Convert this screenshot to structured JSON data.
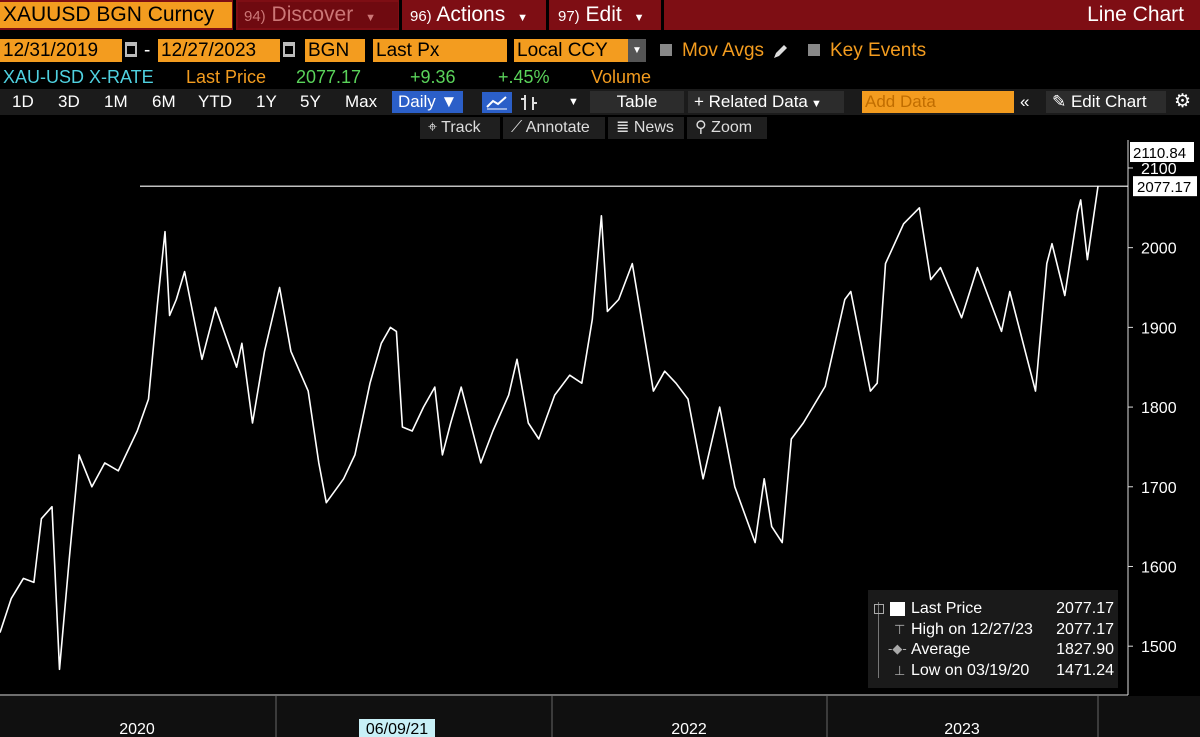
{
  "topbar": {
    "ticker": "XAUUSD BGN Curncy",
    "discover_num": "94)",
    "discover": "Discover",
    "actions_num": "96)",
    "actions": "Actions",
    "edit_num": "97)",
    "edit": "Edit",
    "chart_type": "Line Chart"
  },
  "options": {
    "start_date": "12/31/2019",
    "dash": "-",
    "end_date": "12/27/2023",
    "source": "BGN",
    "field": "Last Px",
    "currency": "Local CCY",
    "mov_avgs": "Mov Avgs",
    "key_events": "Key Events"
  },
  "security": {
    "name": "XAU-USD X-RATE",
    "last_price_label": "Last Price",
    "last_price": "2077.17",
    "change": "+9.36",
    "change_pct": "+.45%",
    "volume_label": "Volume"
  },
  "toolbar": {
    "periods": [
      "1D",
      "3D",
      "1M",
      "6M",
      "YTD",
      "1Y",
      "5Y",
      "Max"
    ],
    "frequency": "Daily",
    "table": "Table",
    "related_data": "Related Data",
    "add_data_placeholder": "Add Data",
    "edit_chart": "Edit Chart"
  },
  "tools": {
    "track": "Track",
    "annotate": "Annotate",
    "news": "News",
    "zoom": "Zoom"
  },
  "legend": {
    "last_price_label": "Last Price",
    "last_price": "2077.17",
    "high_label": "High on 12/27/23",
    "high": "2077.17",
    "average_label": "Average",
    "average": "1827.90",
    "low_label": "Low on 03/19/20",
    "low": "1471.24"
  },
  "colors": {
    "orange": "#f39c1f",
    "header_red": "#7e0e14",
    "cyan": "#4fd1e0",
    "green": "#5ad35a",
    "line": "#ffffff"
  },
  "chart_data": {
    "type": "line",
    "series": [
      {
        "name": "Last Price",
        "x": [
          "2019-12-31",
          "2020-01-15",
          "2020-01-31",
          "2020-02-14",
          "2020-02-24",
          "2020-03-09",
          "2020-03-19",
          "2020-04-01",
          "2020-04-14",
          "2020-05-01",
          "2020-05-18",
          "2020-06-05",
          "2020-06-30",
          "2020-07-15",
          "2020-07-27",
          "2020-08-06",
          "2020-08-12",
          "2020-08-21",
          "2020-09-01",
          "2020-09-24",
          "2020-10-12",
          "2020-11-09",
          "2020-11-16",
          "2020-11-30",
          "2020-12-16",
          "2021-01-05",
          "2021-01-20",
          "2021-02-12",
          "2021-02-26",
          "2021-03-08",
          "2021-03-31",
          "2021-04-15",
          "2021-05-05",
          "2021-05-20",
          "2021-06-01",
          "2021-06-09",
          "2021-06-17",
          "2021-06-30",
          "2021-07-15",
          "2021-07-30",
          "2021-08-09",
          "2021-08-20",
          "2021-09-03",
          "2021-09-29",
          "2021-10-15",
          "2021-11-05",
          "2021-11-16",
          "2021-12-01",
          "2021-12-15",
          "2022-01-05",
          "2022-01-25",
          "2022-02-10",
          "2022-02-24",
          "2022-03-08",
          "2022-03-16",
          "2022-03-31",
          "2022-04-18",
          "2022-05-16",
          "2022-05-31",
          "2022-06-15",
          "2022-07-01",
          "2022-07-21",
          "2022-08-12",
          "2022-09-01",
          "2022-09-28",
          "2022-10-10",
          "2022-10-20",
          "2022-11-03",
          "2022-11-15",
          "2022-12-01",
          "2022-12-30",
          "2023-01-25",
          "2023-02-02",
          "2023-02-28",
          "2023-03-09",
          "2023-03-20",
          "2023-04-13",
          "2023-05-04",
          "2023-05-19",
          "2023-06-01",
          "2023-06-29",
          "2023-07-20",
          "2023-08-21",
          "2023-09-01",
          "2023-10-05",
          "2023-10-20",
          "2023-10-27",
          "2023-11-13",
          "2023-11-30",
          "2023-12-04",
          "2023-12-13",
          "2023-12-27"
        ],
        "values": [
          1517,
          1560,
          1585,
          1580,
          1660,
          1675,
          1471,
          1610,
          1740,
          1700,
          1730,
          1720,
          1770,
          1810,
          1930,
          2020,
          1915,
          1935,
          1970,
          1860,
          1925,
          1850,
          1880,
          1780,
          1870,
          1950,
          1870,
          1820,
          1730,
          1680,
          1710,
          1740,
          1830,
          1880,
          1900,
          1895,
          1775,
          1770,
          1800,
          1825,
          1740,
          1780,
          1825,
          1730,
          1770,
          1815,
          1860,
          1780,
          1760,
          1815,
          1840,
          1830,
          1910,
          2040,
          1920,
          1935,
          1980,
          1820,
          1845,
          1830,
          1810,
          1710,
          1800,
          1700,
          1630,
          1710,
          1650,
          1630,
          1760,
          1780,
          1826,
          1935,
          1945,
          1820,
          1830,
          1980,
          2030,
          2050,
          1960,
          1975,
          1912,
          1975,
          1895,
          1945,
          1820,
          1980,
          2005,
          1940,
          2045,
          2060,
          1985,
          2077.17
        ]
      }
    ],
    "ylim": [
      1440,
      2110
    ],
    "y_ticks": [
      1500,
      1600,
      1700,
      1800,
      1900,
      2000,
      2100
    ],
    "x_tick_labels": [
      "2020",
      "06/09/21",
      "2022",
      "2023"
    ],
    "reference_line": 2077.17,
    "price_labels": [
      "2110.84",
      "2077.17"
    ],
    "grid": false,
    "legend_position": "bottom-right"
  }
}
